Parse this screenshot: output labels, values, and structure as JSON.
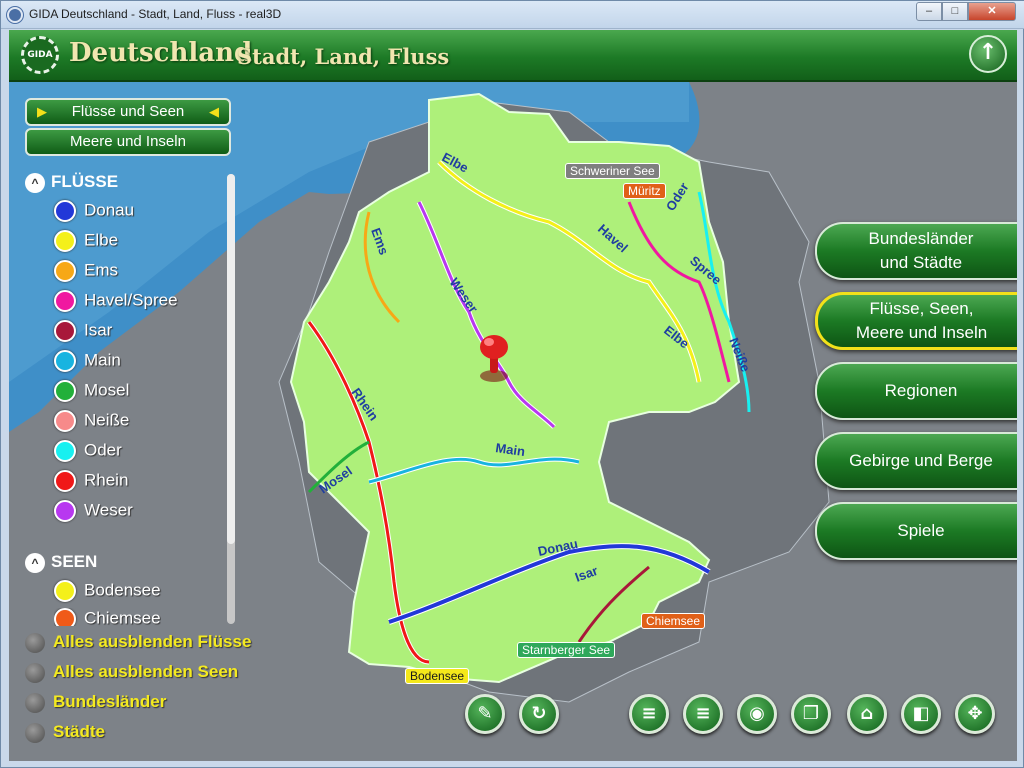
{
  "window": {
    "title": "GIDA Deutschland - Stadt, Land, Fluss - real3D",
    "min": "–",
    "max": "□",
    "close": "✕"
  },
  "header": {
    "logo_text": "GIDA",
    "title": "Deutschland",
    "subtitle": "Stadt, Land, Fluss",
    "up_icon": "up-arrow-icon"
  },
  "tabs": [
    {
      "label": "Flüsse und Seen",
      "active": true
    },
    {
      "label": "Meere und Inseln",
      "active": false
    }
  ],
  "sections": {
    "rivers": {
      "heading": "FLÜSSE",
      "items": [
        {
          "label": "Donau",
          "color": "#2238d8"
        },
        {
          "label": "Elbe",
          "color": "#f4f01a"
        },
        {
          "label": "Ems",
          "color": "#f7a816"
        },
        {
          "label": "Havel/Spree",
          "color": "#f018a0"
        },
        {
          "label": "Isar",
          "color": "#a8183a"
        },
        {
          "label": "Main",
          "color": "#18b4e0"
        },
        {
          "label": "Mosel",
          "color": "#22b03a"
        },
        {
          "label": "Neiße",
          "color": "#f78a8a"
        },
        {
          "label": "Oder",
          "color": "#18f0f0"
        },
        {
          "label": "Rhein",
          "color": "#f01818"
        },
        {
          "label": "Weser",
          "color": "#b838f0"
        }
      ]
    },
    "lakes": {
      "heading": "SEEN",
      "items": [
        {
          "label": "Bodensee",
          "color": "#f4f01a"
        },
        {
          "label": "Chiemsee",
          "color": "#f05a18"
        }
      ]
    }
  },
  "filters": [
    "Alles ausblenden Flüsse",
    "Alles ausblenden Seen",
    "Bundesländer",
    "Städte"
  ],
  "menu": [
    {
      "label1": "Bundesländer",
      "label2": "und Städte",
      "active": false
    },
    {
      "label1": "Flüsse, Seen,",
      "label2": "Meere und Inseln",
      "active": true
    },
    {
      "label1": "Regionen",
      "label2": "",
      "active": false
    },
    {
      "label1": "Gebirge und Berge",
      "label2": "",
      "active": false
    },
    {
      "label1": "Spiele",
      "label2": "",
      "active": false
    }
  ],
  "map": {
    "river_labels": [
      "Elbe",
      "Ems",
      "Weser",
      "Havel",
      "Oder",
      "Spree",
      "Elbe",
      "Neiße",
      "Rhein",
      "Main",
      "Mosel",
      "Donau",
      "Isar"
    ],
    "lake_labels": [
      {
        "text": "Schweriner See",
        "color": "#7f7f7f"
      },
      {
        "text": "Müritz",
        "color": "#e06018"
      },
      {
        "text": "Chiemsee",
        "color": "#e06018"
      },
      {
        "text": "Starnberger See",
        "color": "#2fa85a"
      },
      {
        "text": "Bodensee",
        "color": "#f4e81a"
      }
    ]
  },
  "toolbar": [
    "pointer-icon",
    "reset-icon",
    "list-icon",
    "list-icon",
    "camera-icon",
    "copy-icon",
    "home-icon",
    "window-icon",
    "move-icon"
  ]
}
